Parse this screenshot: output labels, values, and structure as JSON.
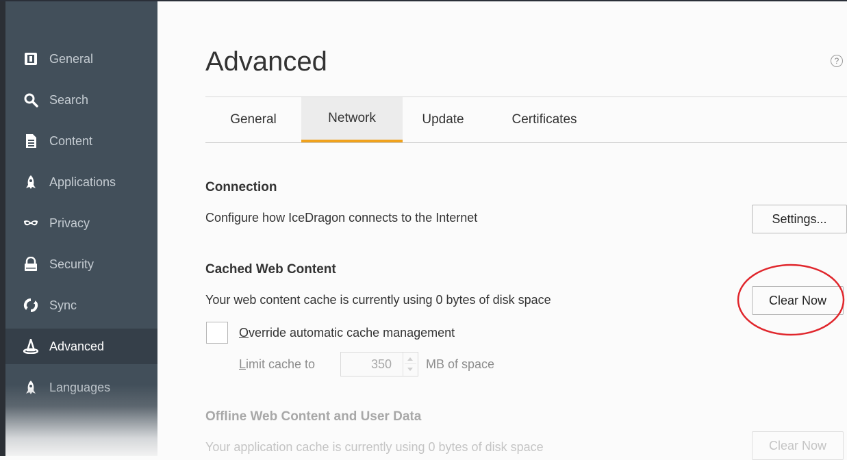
{
  "sidebar": {
    "items": [
      {
        "label": "General",
        "icon": "general-icon"
      },
      {
        "label": "Search",
        "icon": "search-icon"
      },
      {
        "label": "Content",
        "icon": "document-icon"
      },
      {
        "label": "Applications",
        "icon": "rocket-icon"
      },
      {
        "label": "Privacy",
        "icon": "mask-icon"
      },
      {
        "label": "Security",
        "icon": "lock-icon"
      },
      {
        "label": "Sync",
        "icon": "sync-icon"
      },
      {
        "label": "Advanced",
        "icon": "wizard-hat-icon",
        "active": true
      },
      {
        "label": "Languages",
        "icon": "rocket-icon"
      }
    ]
  },
  "header": {
    "title": "Advanced",
    "help_glyph": "?"
  },
  "tabs": [
    {
      "label": "General"
    },
    {
      "label": "Network",
      "selected": true
    },
    {
      "label": "Update"
    },
    {
      "label": "Certificates"
    }
  ],
  "connection": {
    "title": "Connection",
    "description": "Configure how IceDragon connects to the Internet",
    "button_label": "Settings..."
  },
  "cache": {
    "title": "Cached Web Content",
    "description": "Your web content cache is currently using 0 bytes of disk space",
    "button_label": "Clear Now",
    "override_label": "Override automatic cache management",
    "override_checked": false,
    "limit_label": "Limit cache to",
    "limit_value": "350",
    "limit_unit": "MB of space"
  },
  "offline": {
    "title": "Offline Web Content and User Data",
    "description": "Your application cache is currently using 0 bytes of disk space",
    "button_label": "Clear Now"
  },
  "colors": {
    "sidebar_bg": "#424f5a",
    "sidebar_active_bg": "#353f49",
    "tab_accent": "#f0a21d",
    "annotation_circle": "#e0262c"
  }
}
